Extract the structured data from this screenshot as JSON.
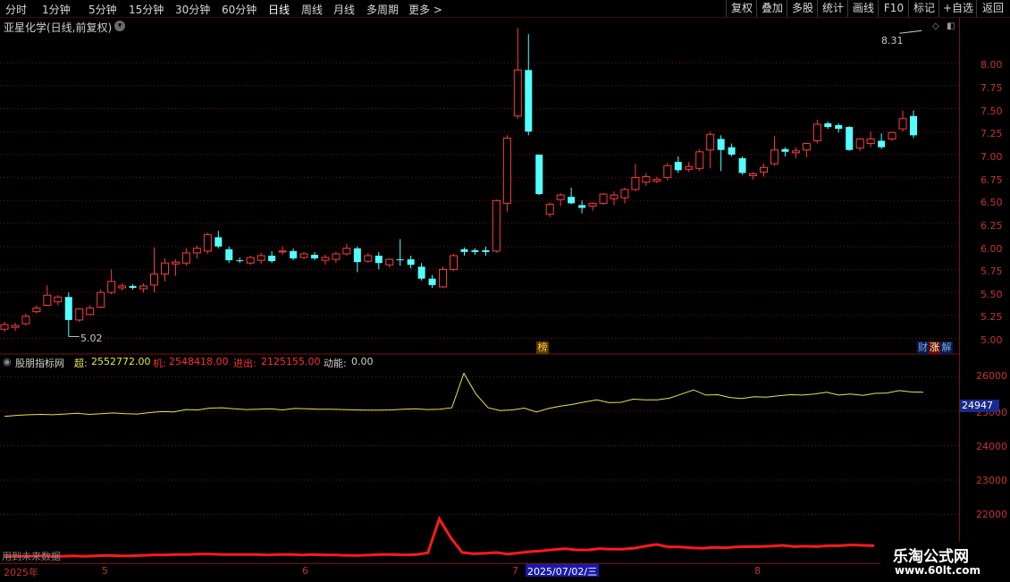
{
  "toolbar": {
    "periods": [
      "分时",
      "1分钟",
      "5分钟",
      "15分钟",
      "30分钟",
      "60分钟",
      "日线",
      "周线",
      "月线",
      "多周期",
      "更多 >"
    ],
    "active_period": "日线",
    "actions": [
      "复权",
      "叠加",
      "多股",
      "统计",
      "画线",
      "F10",
      "标记",
      "+自选",
      "返回"
    ]
  },
  "stock": {
    "title": "亚星化学(日线,前复权)",
    "high_marker": "8.31",
    "low_marker": "5.02"
  },
  "price_axis": {
    "labels": [
      "8.00",
      "7.75",
      "7.50",
      "7.25",
      "7.00",
      "6.75",
      "6.50",
      "6.25",
      "6.00",
      "5.75",
      "5.50",
      "5.25",
      "5.00"
    ]
  },
  "badges": {
    "list_badge": "榜",
    "finance": "财",
    "rise": "涨",
    "explain": "解"
  },
  "indicator": {
    "name": "股朋指标网",
    "chao_label": "超:",
    "chao_value": "2552772.00",
    "ji_label": "机:",
    "ji_value": "2548418.00",
    "jinchu_label": "进出:",
    "jinchu_value": "2125155.00",
    "dongneng_label": "动能:",
    "dongneng_value": "0.00",
    "axis_labels": [
      "26000",
      "25000",
      "24000",
      "23000",
      "22000"
    ],
    "current_value": "24947",
    "bottom_text": "用到未来数据"
  },
  "date_axis": {
    "labels": [
      "2025年",
      "5",
      "6",
      "7",
      "8"
    ],
    "selected": "2025/07/02/三"
  },
  "brand": {
    "name": "乐淘公式网",
    "url": "www.60lt.com"
  },
  "colors": {
    "up": "#ff3c3c",
    "down": "#54ffff",
    "line_yellow": "#e6e64a",
    "line_red": "#ff1a1a",
    "grid": "#7a1010"
  },
  "chart_data": {
    "type": "candlestick",
    "candles": [
      {
        "o": 5.1,
        "h": 5.18,
        "l": 5.07,
        "c": 5.15
      },
      {
        "o": 5.12,
        "h": 5.17,
        "l": 5.08,
        "c": 5.14
      },
      {
        "o": 5.16,
        "h": 5.27,
        "l": 5.14,
        "c": 5.24
      },
      {
        "o": 5.29,
        "h": 5.36,
        "l": 5.27,
        "c": 5.33
      },
      {
        "o": 5.36,
        "h": 5.58,
        "l": 5.35,
        "c": 5.47
      },
      {
        "o": 5.4,
        "h": 5.47,
        "l": 5.36,
        "c": 5.45
      },
      {
        "o": 5.45,
        "h": 5.5,
        "l": 5.02,
        "c": 5.2
      },
      {
        "o": 5.2,
        "h": 5.33,
        "l": 5.18,
        "c": 5.32
      },
      {
        "o": 5.26,
        "h": 5.36,
        "l": 5.25,
        "c": 5.33
      },
      {
        "o": 5.34,
        "h": 5.53,
        "l": 5.33,
        "c": 5.5
      },
      {
        "o": 5.5,
        "h": 5.75,
        "l": 5.48,
        "c": 5.62
      },
      {
        "o": 5.55,
        "h": 5.6,
        "l": 5.52,
        "c": 5.57
      },
      {
        "o": 5.57,
        "h": 5.59,
        "l": 5.53,
        "c": 5.55
      },
      {
        "o": 5.54,
        "h": 5.6,
        "l": 5.5,
        "c": 5.57
      },
      {
        "o": 5.58,
        "h": 5.99,
        "l": 5.5,
        "c": 5.7
      },
      {
        "o": 5.7,
        "h": 5.87,
        "l": 5.62,
        "c": 5.82
      },
      {
        "o": 5.81,
        "h": 5.86,
        "l": 5.68,
        "c": 5.83
      },
      {
        "o": 5.82,
        "h": 5.98,
        "l": 5.79,
        "c": 5.93
      },
      {
        "o": 5.93,
        "h": 6.01,
        "l": 5.87,
        "c": 5.98
      },
      {
        "o": 5.95,
        "h": 6.15,
        "l": 5.92,
        "c": 6.13
      },
      {
        "o": 6.1,
        "h": 6.17,
        "l": 5.98,
        "c": 6.0
      },
      {
        "o": 5.97,
        "h": 6.0,
        "l": 5.82,
        "c": 5.85
      },
      {
        "o": 5.85,
        "h": 5.88,
        "l": 5.82,
        "c": 5.84
      },
      {
        "o": 5.82,
        "h": 5.9,
        "l": 5.8,
        "c": 5.88
      },
      {
        "o": 5.85,
        "h": 5.93,
        "l": 5.81,
        "c": 5.9
      },
      {
        "o": 5.9,
        "h": 5.95,
        "l": 5.82,
        "c": 5.84
      },
      {
        "o": 5.94,
        "h": 6.0,
        "l": 5.91,
        "c": 5.95
      },
      {
        "o": 5.95,
        "h": 5.98,
        "l": 5.85,
        "c": 5.87
      },
      {
        "o": 5.88,
        "h": 5.94,
        "l": 5.86,
        "c": 5.92
      },
      {
        "o": 5.91,
        "h": 5.94,
        "l": 5.85,
        "c": 5.87
      },
      {
        "o": 5.85,
        "h": 5.91,
        "l": 5.8,
        "c": 5.88
      },
      {
        "o": 5.86,
        "h": 5.94,
        "l": 5.82,
        "c": 5.92
      },
      {
        "o": 5.92,
        "h": 6.03,
        "l": 5.9,
        "c": 5.98
      },
      {
        "o": 5.98,
        "h": 6.0,
        "l": 5.72,
        "c": 5.83
      },
      {
        "o": 5.84,
        "h": 5.93,
        "l": 5.82,
        "c": 5.9
      },
      {
        "o": 5.9,
        "h": 5.94,
        "l": 5.75,
        "c": 5.82
      },
      {
        "o": 5.8,
        "h": 5.87,
        "l": 5.77,
        "c": 5.86
      },
      {
        "o": 5.86,
        "h": 6.08,
        "l": 5.79,
        "c": 5.85
      },
      {
        "o": 5.86,
        "h": 5.9,
        "l": 5.76,
        "c": 5.8
      },
      {
        "o": 5.78,
        "h": 5.82,
        "l": 5.63,
        "c": 5.65
      },
      {
        "o": 5.65,
        "h": 5.69,
        "l": 5.55,
        "c": 5.58
      },
      {
        "o": 5.56,
        "h": 5.78,
        "l": 5.55,
        "c": 5.75
      },
      {
        "o": 5.75,
        "h": 5.92,
        "l": 5.73,
        "c": 5.9
      },
      {
        "o": 5.97,
        "h": 5.99,
        "l": 5.9,
        "c": 5.94
      },
      {
        "o": 5.96,
        "h": 5.98,
        "l": 5.91,
        "c": 5.94
      },
      {
        "o": 5.96,
        "h": 6.0,
        "l": 5.9,
        "c": 5.94
      },
      {
        "o": 5.95,
        "h": 6.51,
        "l": 5.93,
        "c": 6.5
      },
      {
        "o": 6.47,
        "h": 7.21,
        "l": 6.38,
        "c": 7.18
      },
      {
        "o": 7.42,
        "h": 8.38,
        "l": 7.39,
        "c": 7.92
      },
      {
        "o": 7.92,
        "h": 8.31,
        "l": 7.21,
        "c": 7.25
      },
      {
        "o": 7.0,
        "h": 7.0,
        "l": 6.56,
        "c": 6.57
      },
      {
        "o": 6.35,
        "h": 6.48,
        "l": 6.32,
        "c": 6.46
      },
      {
        "o": 6.51,
        "h": 6.58,
        "l": 6.44,
        "c": 6.56
      },
      {
        "o": 6.54,
        "h": 6.64,
        "l": 6.46,
        "c": 6.47
      },
      {
        "o": 6.45,
        "h": 6.5,
        "l": 6.36,
        "c": 6.42
      },
      {
        "o": 6.44,
        "h": 6.48,
        "l": 6.39,
        "c": 6.47
      },
      {
        "o": 6.47,
        "h": 6.58,
        "l": 6.45,
        "c": 6.57
      },
      {
        "o": 6.52,
        "h": 6.6,
        "l": 6.45,
        "c": 6.56
      },
      {
        "o": 6.53,
        "h": 6.64,
        "l": 6.47,
        "c": 6.62
      },
      {
        "o": 6.62,
        "h": 6.9,
        "l": 6.6,
        "c": 6.75
      },
      {
        "o": 6.7,
        "h": 6.8,
        "l": 6.66,
        "c": 6.76
      },
      {
        "o": 6.71,
        "h": 6.76,
        "l": 6.69,
        "c": 6.73
      },
      {
        "o": 6.75,
        "h": 6.91,
        "l": 6.72,
        "c": 6.88
      },
      {
        "o": 6.92,
        "h": 6.98,
        "l": 6.8,
        "c": 6.83
      },
      {
        "o": 6.84,
        "h": 6.92,
        "l": 6.81,
        "c": 6.87
      },
      {
        "o": 6.85,
        "h": 7.06,
        "l": 6.82,
        "c": 7.03
      },
      {
        "o": 7.05,
        "h": 7.25,
        "l": 6.85,
        "c": 7.22
      },
      {
        "o": 7.17,
        "h": 7.21,
        "l": 6.82,
        "c": 7.05
      },
      {
        "o": 7.08,
        "h": 7.12,
        "l": 6.98,
        "c": 7.0
      },
      {
        "o": 6.96,
        "h": 6.98,
        "l": 6.78,
        "c": 6.8
      },
      {
        "o": 6.77,
        "h": 6.81,
        "l": 6.73,
        "c": 6.79
      },
      {
        "o": 6.81,
        "h": 6.9,
        "l": 6.76,
        "c": 6.86
      },
      {
        "o": 6.9,
        "h": 7.2,
        "l": 6.88,
        "c": 7.05
      },
      {
        "o": 7.06,
        "h": 7.08,
        "l": 6.98,
        "c": 7.03
      },
      {
        "o": 7.02,
        "h": 7.08,
        "l": 6.96,
        "c": 7.04
      },
      {
        "o": 7.05,
        "h": 7.13,
        "l": 6.97,
        "c": 7.12
      },
      {
        "o": 7.15,
        "h": 7.38,
        "l": 7.12,
        "c": 7.33
      },
      {
        "o": 7.34,
        "h": 7.36,
        "l": 7.28,
        "c": 7.3
      },
      {
        "o": 7.32,
        "h": 7.34,
        "l": 7.24,
        "c": 7.28
      },
      {
        "o": 7.3,
        "h": 7.31,
        "l": 7.04,
        "c": 7.05
      },
      {
        "o": 7.07,
        "h": 7.18,
        "l": 7.04,
        "c": 7.17
      },
      {
        "o": 7.12,
        "h": 7.25,
        "l": 7.08,
        "c": 7.17
      },
      {
        "o": 7.15,
        "h": 7.23,
        "l": 7.06,
        "c": 7.08
      },
      {
        "o": 7.17,
        "h": 7.25,
        "l": 7.15,
        "c": 7.24
      },
      {
        "o": 7.28,
        "h": 7.48,
        "l": 7.25,
        "c": 7.39
      },
      {
        "o": 7.42,
        "h": 7.48,
        "l": 7.18,
        "c": 7.21
      }
    ],
    "indicator_yellow": [
      24850,
      24880,
      24900,
      24910,
      24900,
      24920,
      24940,
      24910,
      24930,
      24950,
      24930,
      24920,
      24960,
      24990,
      24980,
      25050,
      25040,
      25090,
      25100,
      25070,
      25050,
      25060,
      25070,
      25040,
      25080,
      25070,
      25060,
      25060,
      25050,
      25040,
      25030,
      25030,
      25040,
      25060,
      25070,
      25050,
      25060,
      25100,
      26100,
      25500,
      25100,
      25020,
      25040,
      25090,
      24980,
      25080,
      25150,
      25200,
      25270,
      25330,
      25250,
      25260,
      25350,
      25330,
      25330,
      25380,
      25500,
      25620,
      25470,
      25480,
      25400,
      25370,
      25420,
      25410,
      25450,
      25480,
      25470,
      25500,
      25550,
      25470,
      25500,
      25460,
      25520,
      25530,
      25600,
      25560,
      25550
    ],
    "indicator_red_level": [
      0.05,
      0.06,
      0.06,
      0.07,
      0.06,
      0.06,
      0.07,
      0.06,
      0.07,
      0.08,
      0.07,
      0.07,
      0.08,
      0.09,
      0.09,
      0.1,
      0.1,
      0.11,
      0.11,
      0.1,
      0.1,
      0.1,
      0.1,
      0.09,
      0.1,
      0.1,
      0.09,
      0.1,
      0.09,
      0.09,
      0.08,
      0.08,
      0.09,
      0.1,
      0.1,
      0.09,
      0.1,
      0.14,
      0.95,
      0.5,
      0.15,
      0.12,
      0.13,
      0.15,
      0.11,
      0.14,
      0.17,
      0.19,
      0.22,
      0.24,
      0.21,
      0.21,
      0.24,
      0.23,
      0.23,
      0.25,
      0.3,
      0.34,
      0.28,
      0.28,
      0.26,
      0.25,
      0.27,
      0.26,
      0.28,
      0.29,
      0.29,
      0.3,
      0.32,
      0.29,
      0.3,
      0.29,
      0.31,
      0.31,
      0.33,
      0.32,
      0.31
    ]
  }
}
